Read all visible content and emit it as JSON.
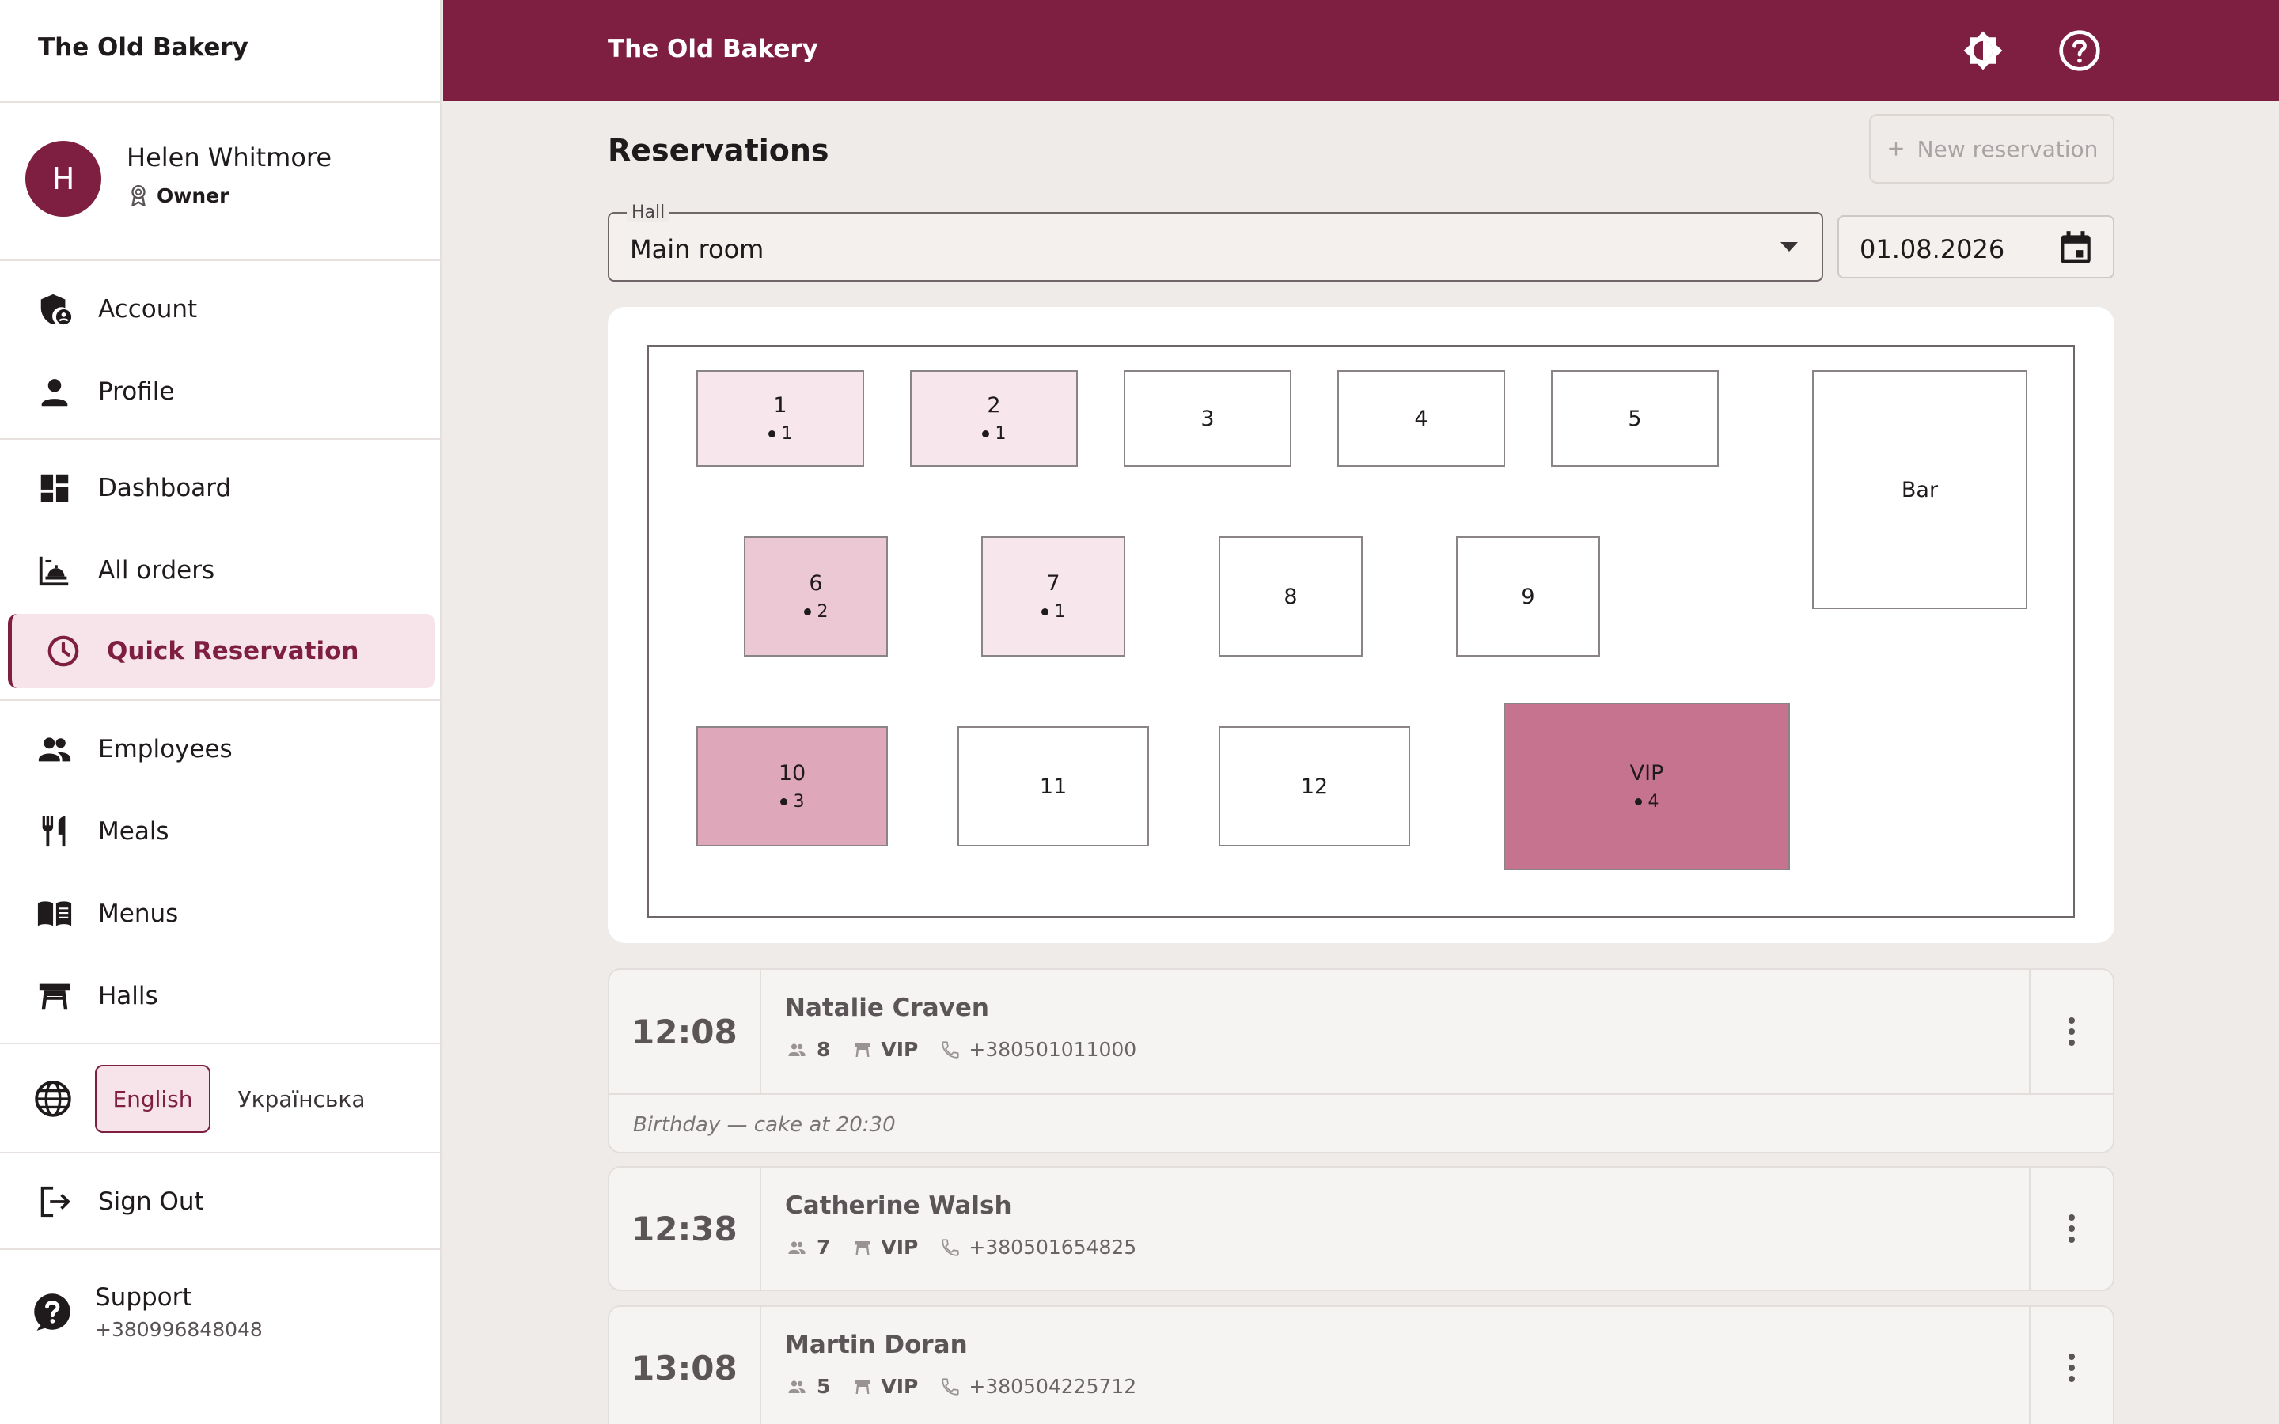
{
  "app": {
    "brand": "The Old Bakery"
  },
  "user": {
    "initial": "H",
    "name": "Helen Whitmore",
    "role": "Owner"
  },
  "nav": {
    "account": "Account",
    "profile": "Profile",
    "dashboard": "Dashboard",
    "all_orders": "All orders",
    "quick_reservation": "Quick Reservation",
    "employees": "Employees",
    "meals": "Meals",
    "menus": "Menus",
    "halls": "Halls"
  },
  "language": {
    "english": "English",
    "ukrainian": "Українська",
    "selected": "English"
  },
  "sign_out": "Sign Out",
  "support": {
    "title": "Support",
    "phone": "+380996848048"
  },
  "header": {
    "title": "The Old Bakery",
    "theme_icon": "brightness-icon",
    "help_icon": "help-circle-icon"
  },
  "page": {
    "title": "Reservations",
    "new_reservation": "New reservation"
  },
  "filters": {
    "hall_label": "Hall",
    "hall_value": "Main room",
    "date": "01.08.2026"
  },
  "floor_plan": {
    "tables": [
      {
        "label": "1",
        "count": "1"
      },
      {
        "label": "2",
        "count": "1"
      },
      {
        "label": "3",
        "count": ""
      },
      {
        "label": "4",
        "count": ""
      },
      {
        "label": "5",
        "count": ""
      },
      {
        "label": "Bar",
        "count": ""
      },
      {
        "label": "6",
        "count": "2"
      },
      {
        "label": "7",
        "count": "1"
      },
      {
        "label": "8",
        "count": ""
      },
      {
        "label": "9",
        "count": ""
      },
      {
        "label": "10",
        "count": "3"
      },
      {
        "label": "11",
        "count": ""
      },
      {
        "label": "12",
        "count": ""
      },
      {
        "label": "VIP",
        "count": "4"
      }
    ],
    "colors": {
      "level1": "#f7e6ec",
      "level2": "#ecc8d5",
      "level3": "#dea7ba",
      "level4": "#c67390",
      "empty": "#ffffff"
    }
  },
  "reservations": [
    {
      "time": "12:08",
      "name": "Natalie Craven",
      "guests": "8",
      "table": "VIP",
      "phone": "+380501011000",
      "note": "Birthday — cake at 20:30"
    },
    {
      "time": "12:38",
      "name": "Catherine Walsh",
      "guests": "7",
      "table": "VIP",
      "phone": "+380501654825",
      "note": ""
    },
    {
      "time": "13:08",
      "name": "Martin Doran",
      "guests": "5",
      "table": "VIP",
      "phone": "+380504225712",
      "note": ""
    }
  ],
  "accent_color": "#7e1f41"
}
